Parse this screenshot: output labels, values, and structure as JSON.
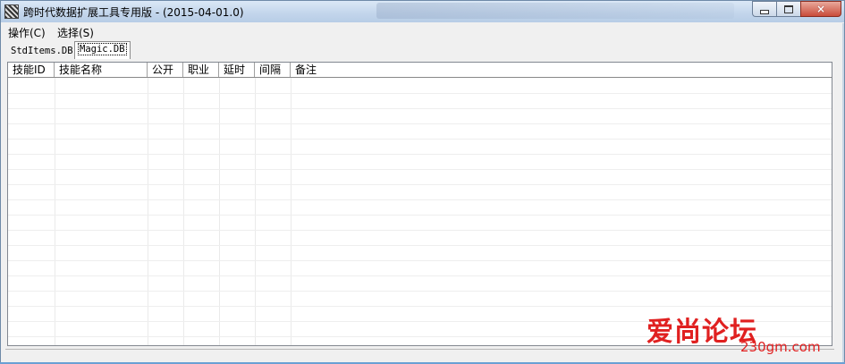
{
  "window": {
    "title": "跨时代数据扩展工具专用版 - (2015-04-01.0)",
    "controls": {
      "minimize": "minimize",
      "maximize": "maximize",
      "close": "×"
    }
  },
  "menu": {
    "items": [
      {
        "label": "操作(C)"
      },
      {
        "label": "选择(S)"
      }
    ]
  },
  "tabs": [
    {
      "label": "StdItems.DB",
      "active": false
    },
    {
      "label": "Magic.DB",
      "active": true
    }
  ],
  "table": {
    "columns": [
      "技能ID",
      "技能名称",
      "公开",
      "职业",
      "延时",
      "间隔",
      "备注"
    ],
    "rows": []
  },
  "watermark": {
    "main": "爱尚论坛",
    "url": "230gm.com"
  },
  "colors": {
    "titlebar": "#c4d6ec",
    "window_bg": "#f0f0f0",
    "watermark": "#e02020",
    "close_button": "#c94c3a"
  }
}
